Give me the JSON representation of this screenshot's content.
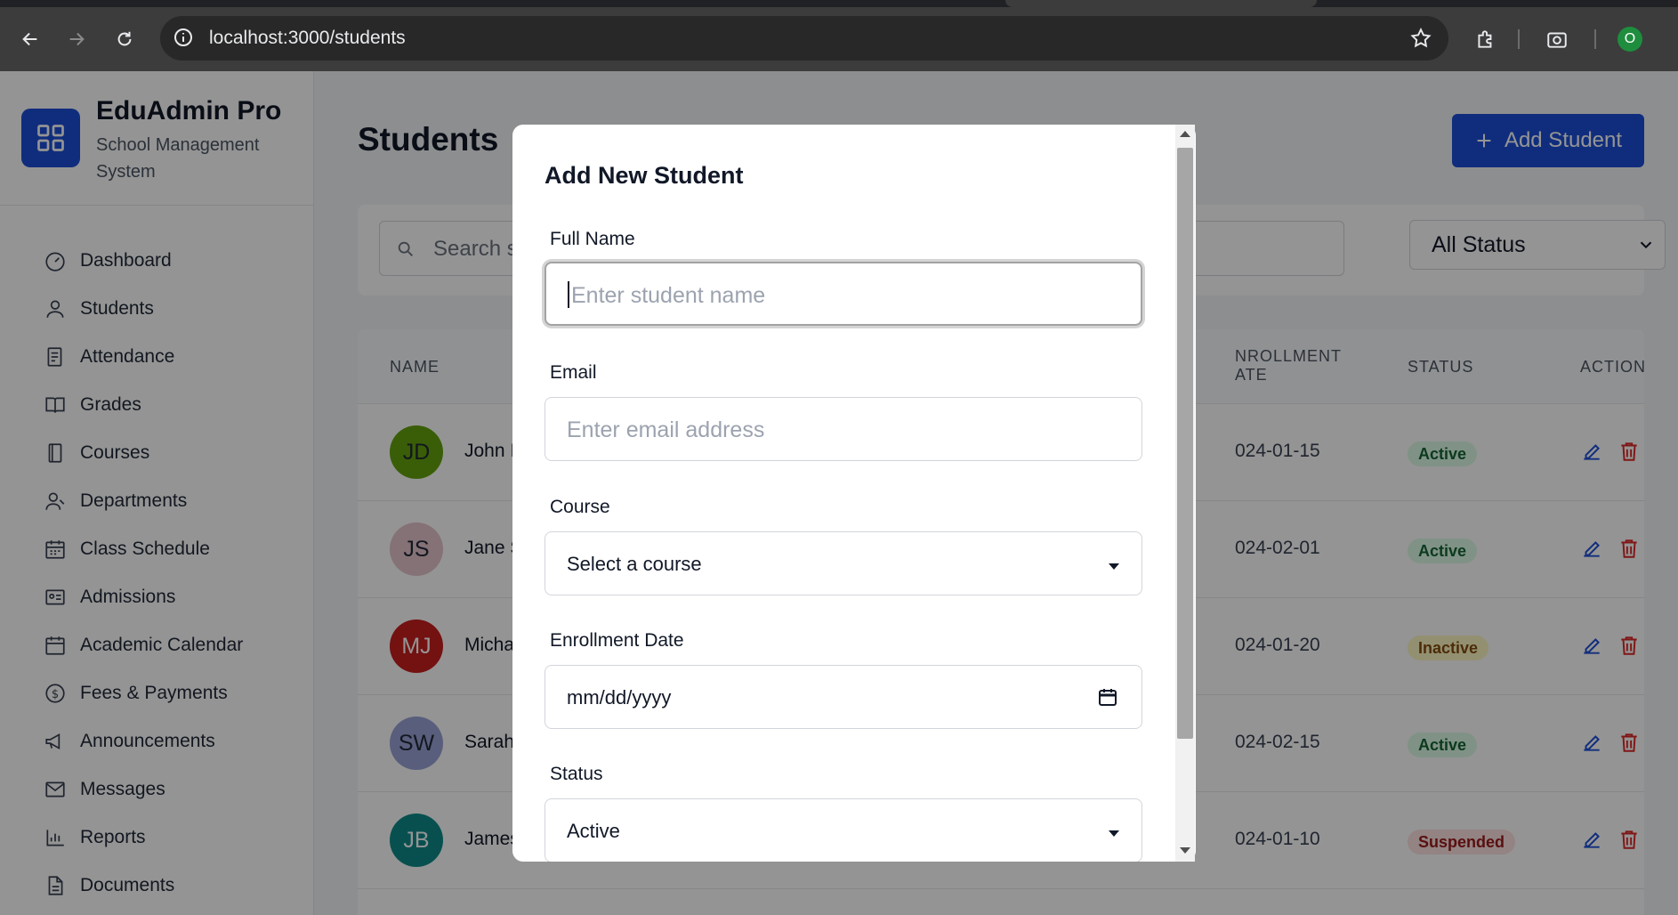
{
  "browser": {
    "url": "localhost:3000/students",
    "profile_initial": "O"
  },
  "brand": {
    "title": "EduAdmin Pro",
    "subtitle": "School Management System"
  },
  "sidebar": {
    "items": [
      {
        "label": "Dashboard",
        "icon": "gauge-icon"
      },
      {
        "label": "Students",
        "icon": "user-icon"
      },
      {
        "label": "Attendance",
        "icon": "clipboard-icon"
      },
      {
        "label": "Grades",
        "icon": "book-open-icon"
      },
      {
        "label": "Courses",
        "icon": "book-icon"
      },
      {
        "label": "Departments",
        "icon": "users-icon"
      },
      {
        "label": "Class Schedule",
        "icon": "calendar-grid-icon"
      },
      {
        "label": "Admissions",
        "icon": "id-card-icon"
      },
      {
        "label": "Academic Calendar",
        "icon": "calendar-icon"
      },
      {
        "label": "Fees & Payments",
        "icon": "dollar-icon"
      },
      {
        "label": "Announcements",
        "icon": "megaphone-icon"
      },
      {
        "label": "Messages",
        "icon": "mail-icon"
      },
      {
        "label": "Reports",
        "icon": "bar-chart-icon"
      },
      {
        "label": "Documents",
        "icon": "file-icon"
      }
    ]
  },
  "main": {
    "title": "Students",
    "add_button": "Add Student",
    "search_placeholder": "Search s",
    "status_filter": "All Status",
    "table": {
      "headers": {
        "name": "NAME",
        "enrollment_line1": "NROLLMENT",
        "enrollment_line2": "ATE",
        "status": "STATUS",
        "actions": "ACTIONS"
      },
      "rows": [
        {
          "initials": "JD",
          "name": "John I",
          "date": "024-01-15",
          "status": "Active",
          "avatar_color": "#65a30d"
        },
        {
          "initials": "JS",
          "name": "Jane S",
          "date": "024-02-01",
          "status": "Active",
          "avatar_color": "#e5c4cb"
        },
        {
          "initials": "MJ",
          "name": "Micha",
          "date": "024-01-20",
          "status": "Inactive",
          "avatar_color": "#c81e1e"
        },
        {
          "initials": "SW",
          "name": "Sarah",
          "date": "024-02-15",
          "status": "Active",
          "avatar_color": "#9aa3d6"
        },
        {
          "initials": "JB",
          "name": "James",
          "date": "024-01-10",
          "status": "Suspended",
          "avatar_color": "#0e8a8a"
        }
      ]
    }
  },
  "modal": {
    "title": "Add New Student",
    "full_name_label": "Full Name",
    "full_name_placeholder": "Enter student name",
    "email_label": "Email",
    "email_placeholder": "Enter email address",
    "course_label": "Course",
    "course_value": "Select a course",
    "enrollment_label": "Enrollment Date",
    "enrollment_value": "mm/dd/yyyy",
    "status_label": "Status",
    "status_value": "Active"
  },
  "colors": {
    "accent": "#1d4ed8",
    "active_badge_bg": "#dcfce7",
    "active_badge_text": "#166534",
    "inactive_badge_bg": "#fef9c3",
    "inactive_badge_text": "#854d0e",
    "suspended_badge_bg": "#fee2e2",
    "suspended_badge_text": "#991b1b"
  }
}
